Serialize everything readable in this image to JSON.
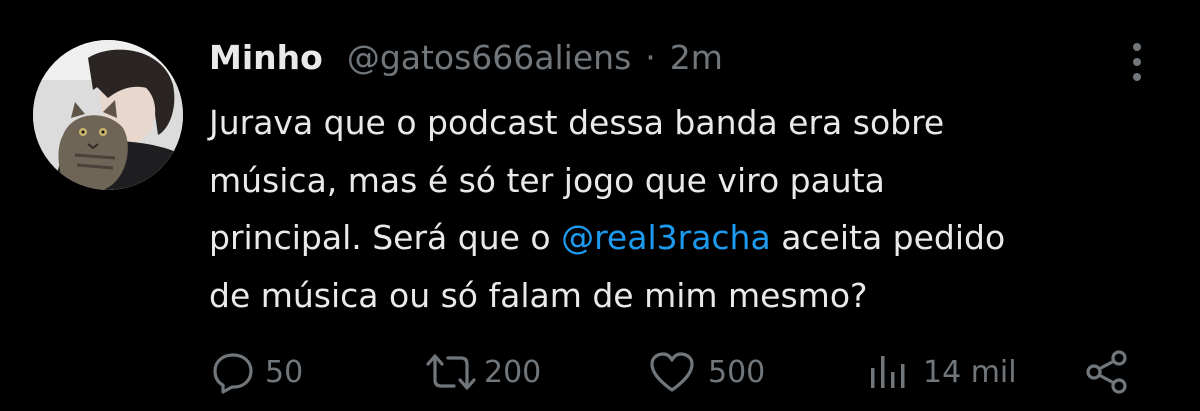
{
  "tweet": {
    "author_name": "Minho",
    "handle": "@gatos666aliens",
    "separator": "·",
    "time": "2m",
    "text_lines": [
      "Jurava que o podcast dessa banda era sobre",
      "música, mas é só ter jogo que viro pauta"
    ],
    "line3_before": "principal. Será que o ",
    "mention": "@real3racha",
    "line3_after": " aceita pedido",
    "line4": "de música ou só falam de mim mesmo?"
  },
  "actions": {
    "replies": "50",
    "retweets": "200",
    "likes": "500",
    "views": "14 mil"
  },
  "icons": {
    "reply": "reply-icon",
    "retweet": "retweet-icon",
    "like": "heart-icon",
    "views": "views-icon",
    "share": "share-icon",
    "more": "more-vertical-icon"
  },
  "colors": {
    "background": "#000000",
    "text": "#e7e9ea",
    "secondary": "#71767b",
    "link": "#1d9bf0"
  }
}
